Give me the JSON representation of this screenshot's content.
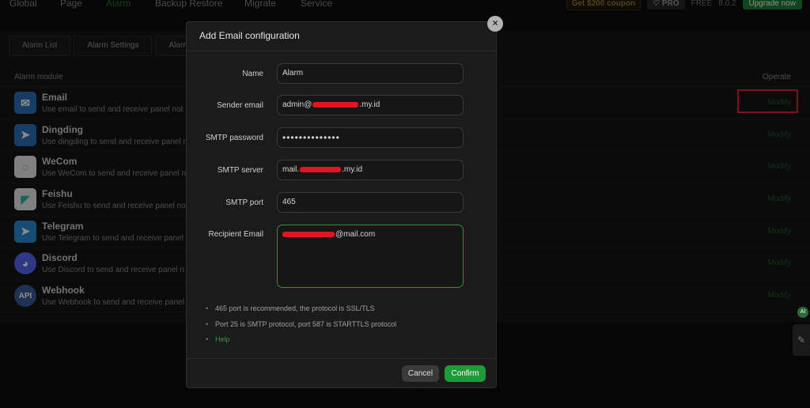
{
  "topnav": {
    "items": [
      "Global",
      "Page",
      "Alarm",
      "Backup Restore",
      "Migrate",
      "Service"
    ],
    "active": "Alarm",
    "coupon": "Get $200 coupon",
    "pro": "PRO",
    "free": "FREE",
    "version": "8.0.2",
    "upgrade": "Upgrade now"
  },
  "tabs": [
    "Alarm List",
    "Alarm Settings",
    "Alarm"
  ],
  "table": {
    "col_module": "Alarm module",
    "col_operate": "Operate",
    "rows": [
      {
        "name": "Email",
        "desc": "Use email to send and receive panel not",
        "op": "Modify",
        "icon": "mail-icon",
        "color": "#2d6fb6"
      },
      {
        "name": "Dingding",
        "desc": "Use dingding to send and receive panel n",
        "op": "Modify",
        "icon": "dingding-icon",
        "color": "#2a6fb8"
      },
      {
        "name": "WeCom",
        "desc": "Use WeCom to send and receive panel n",
        "op": "Modify",
        "icon": "wecom-icon",
        "color": "#e9e9e9"
      },
      {
        "name": "Feishu",
        "desc": "Use Feishu to send and receive panel no",
        "op": "Modify",
        "icon": "feishu-icon",
        "color": "#e9e9e9"
      },
      {
        "name": "Telegram",
        "desc": "Use Telegram to send and receive panel",
        "op": "Modify",
        "icon": "telegram-icon",
        "color": "#2b8ad3"
      },
      {
        "name": "Discord",
        "desc": "Use Discord to send and receive panel n",
        "op": "Modify",
        "icon": "discord-icon",
        "color": "#5865f2"
      },
      {
        "name": "Webhook",
        "desc": "Use Webhook to send and receive panel",
        "op": "Modify",
        "icon": "api-icon",
        "color": "#3d5a9a",
        "icon_text": "API"
      }
    ]
  },
  "side": {
    "ai": "AI"
  },
  "modal": {
    "title": "Add Email configuration",
    "fields": {
      "name": {
        "label": "Name",
        "value": "Alarm"
      },
      "sender": {
        "label": "Sender email",
        "value_prefix": "admin@",
        "value_suffix": ".my.id"
      },
      "password": {
        "label": "SMTP password",
        "value": "••••••••••••••"
      },
      "server": {
        "label": "SMTP server",
        "value_prefix": "mail.",
        "value_suffix": ".my.id"
      },
      "port": {
        "label": "SMTP port",
        "value": "465"
      },
      "recipient": {
        "label": "Recipient Email",
        "value_suffix": "@mail.com"
      }
    },
    "hints": [
      "465 port is recommended, the protocol is SSL/TLS",
      "Port 25 is SMTP protocol, port 587 is STARTTLS protocol"
    ],
    "help": "Help",
    "cancel": "Cancel",
    "confirm": "Confirm"
  }
}
